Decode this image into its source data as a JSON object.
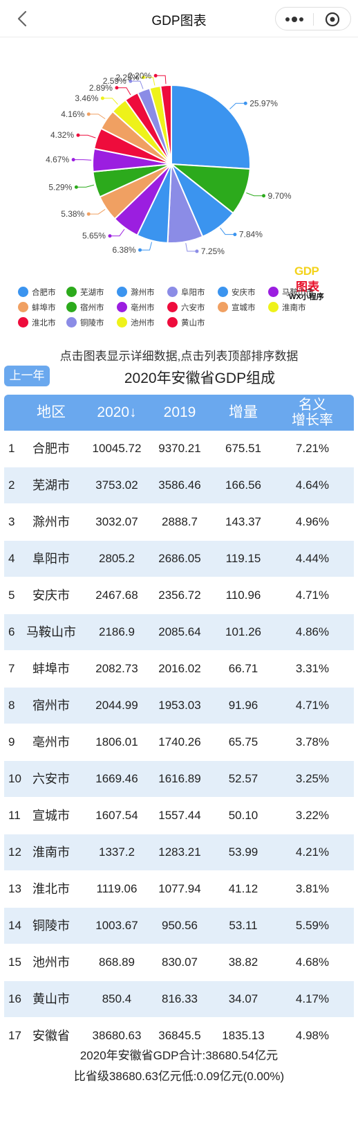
{
  "header": {
    "title": "GDP图表"
  },
  "chart_data": {
    "type": "pie",
    "categories": [
      "合肥市",
      "芜湖市",
      "滁州市",
      "阜阳市",
      "安庆市",
      "马鞍山市",
      "蚌埠市",
      "宿州市",
      "亳州市",
      "六安市",
      "宣城市",
      "淮南市",
      "淮北市",
      "铜陵市",
      "池州市",
      "黄山市"
    ],
    "values": [
      25.97,
      9.7,
      7.84,
      7.25,
      6.38,
      5.65,
      5.38,
      5.29,
      4.67,
      4.32,
      4.16,
      3.46,
      2.89,
      2.59,
      2.25,
      2.2
    ],
    "labels": [
      "25.97%",
      "9.70%",
      "7.84%",
      "7.25%",
      "6.38%",
      "5.65%",
      "5.38%",
      "5.29%",
      "4.67%",
      "4.32%",
      "4.16%",
      "3.46%",
      "2.89%",
      "2.59%",
      "2.25%",
      "2.20%"
    ],
    "colors": [
      "#3b94ef",
      "#2caa1c",
      "#3b94ef",
      "#8b8ce6",
      "#3b94ef",
      "#9b1ee0",
      "#f0a062",
      "#2caa1c",
      "#9b1ee0",
      "#ee0c3c",
      "#f0a062",
      "#eef21a",
      "#ee0c3c",
      "#8b8ce6",
      "#eef21a",
      "#ee0c3c"
    ],
    "legend_placement": "bottom"
  },
  "logo": {
    "line1": "GDP",
    "line2": "图表",
    "line3": "WX小程序"
  },
  "hint": "点击图表显示详细数据,点击列表顶部排序数据",
  "prev_year_label": "上一年",
  "table_title": "2020年安徽省GDP组成",
  "table": {
    "headers": {
      "region": "地区",
      "y2020": "2020↓",
      "y2019": "2019",
      "increase": "增量",
      "rate1": "名义",
      "rate2": "增长率"
    },
    "rows": [
      {
        "idx": "1",
        "name": "合肥市",
        "y2020": "10045.72",
        "y2019": "9370.21",
        "inc": "675.51",
        "rate": "7.21%"
      },
      {
        "idx": "2",
        "name": "芜湖市",
        "y2020": "3753.02",
        "y2019": "3586.46",
        "inc": "166.56",
        "rate": "4.64%"
      },
      {
        "idx": "3",
        "name": "滁州市",
        "y2020": "3032.07",
        "y2019": "2888.7",
        "inc": "143.37",
        "rate": "4.96%"
      },
      {
        "idx": "4",
        "name": "阜阳市",
        "y2020": "2805.2",
        "y2019": "2686.05",
        "inc": "119.15",
        "rate": "4.44%"
      },
      {
        "idx": "5",
        "name": "安庆市",
        "y2020": "2467.68",
        "y2019": "2356.72",
        "inc": "110.96",
        "rate": "4.71%"
      },
      {
        "idx": "6",
        "name": "马鞍山市",
        "y2020": "2186.9",
        "y2019": "2085.64",
        "inc": "101.26",
        "rate": "4.86%"
      },
      {
        "idx": "7",
        "name": "蚌埠市",
        "y2020": "2082.73",
        "y2019": "2016.02",
        "inc": "66.71",
        "rate": "3.31%"
      },
      {
        "idx": "8",
        "name": "宿州市",
        "y2020": "2044.99",
        "y2019": "1953.03",
        "inc": "91.96",
        "rate": "4.71%"
      },
      {
        "idx": "9",
        "name": "亳州市",
        "y2020": "1806.01",
        "y2019": "1740.26",
        "inc": "65.75",
        "rate": "3.78%"
      },
      {
        "idx": "10",
        "name": "六安市",
        "y2020": "1669.46",
        "y2019": "1616.89",
        "inc": "52.57",
        "rate": "3.25%"
      },
      {
        "idx": "11",
        "name": "宣城市",
        "y2020": "1607.54",
        "y2019": "1557.44",
        "inc": "50.10",
        "rate": "3.22%"
      },
      {
        "idx": "12",
        "name": "淮南市",
        "y2020": "1337.2",
        "y2019": "1283.21",
        "inc": "53.99",
        "rate": "4.21%"
      },
      {
        "idx": "13",
        "name": "淮北市",
        "y2020": "1119.06",
        "y2019": "1077.94",
        "inc": "41.12",
        "rate": "3.81%"
      },
      {
        "idx": "14",
        "name": "铜陵市",
        "y2020": "1003.67",
        "y2019": "950.56",
        "inc": "53.11",
        "rate": "5.59%"
      },
      {
        "idx": "15",
        "name": "池州市",
        "y2020": "868.89",
        "y2019": "830.07",
        "inc": "38.82",
        "rate": "4.68%"
      },
      {
        "idx": "16",
        "name": "黄山市",
        "y2020": "850.4",
        "y2019": "816.33",
        "inc": "34.07",
        "rate": "4.17%"
      },
      {
        "idx": "17",
        "name": "安徽省",
        "y2020": "38680.63",
        "y2019": "36845.5",
        "inc": "1835.13",
        "rate": "4.98%"
      }
    ]
  },
  "summary": {
    "line1": "2020年安徽省GDP合计:38680.54亿元",
    "line2": "比省级38680.63亿元低:0.09亿元(0.00%)"
  }
}
